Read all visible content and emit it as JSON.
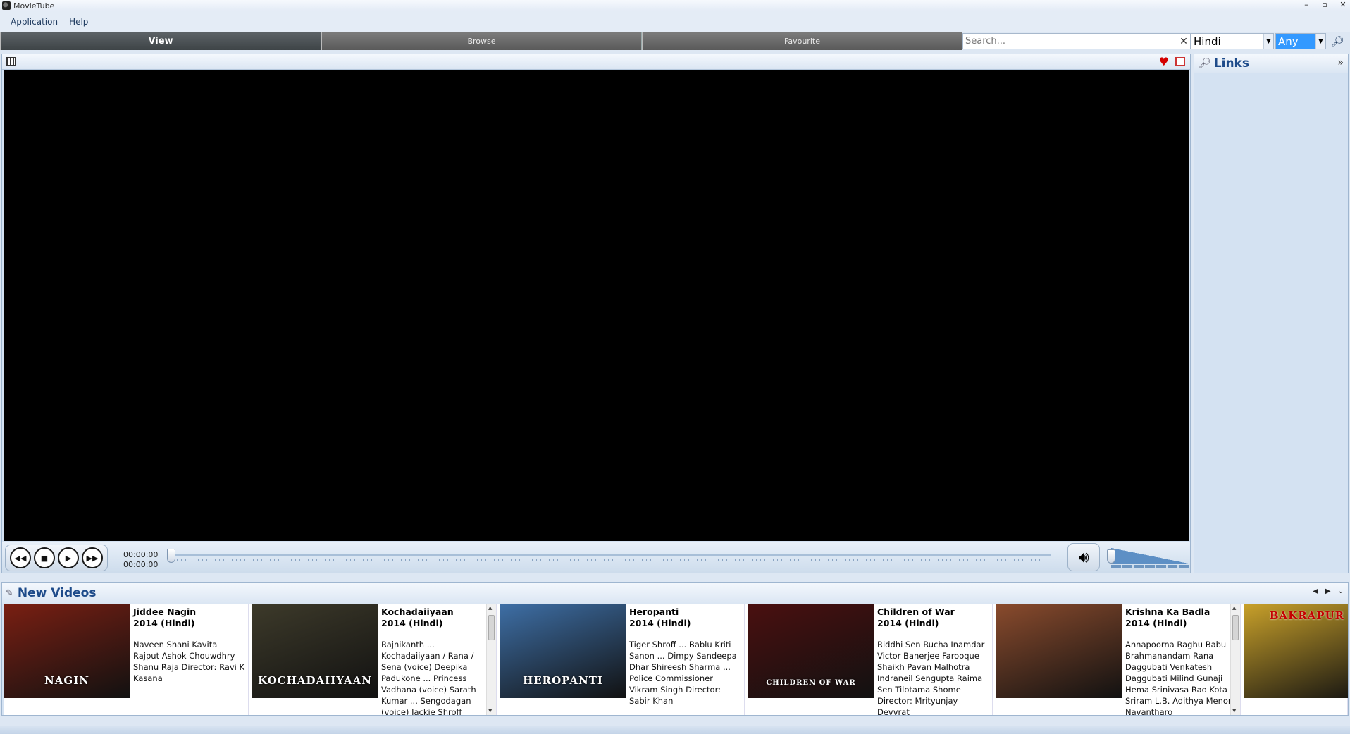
{
  "window": {
    "title": "MovieTube"
  },
  "menu": [
    "Application",
    "Help"
  ],
  "tabs": [
    {
      "label": "View",
      "active": true
    },
    {
      "label": "Browse",
      "active": false
    },
    {
      "label": "Favourite",
      "active": false
    }
  ],
  "search": {
    "placeholder": "Search...",
    "value": ""
  },
  "filters": {
    "language": "Hindi",
    "genre": "Any"
  },
  "player": {
    "time_current": "00:00:00",
    "time_total": "00:00:00",
    "progress": 0,
    "volume": 1.0
  },
  "icons": {
    "window_icon": "film-reel-icon",
    "player": "film-icon",
    "favourite": "heart-icon",
    "fullscreen": "fullscreen-icon",
    "links": "key-icon",
    "new_videos": "pin-icon",
    "search": "magnifier-icon",
    "volume": "speaker-icon"
  },
  "links": {
    "title": "Links"
  },
  "new_videos": {
    "title": "New Videos",
    "items": [
      {
        "name": "Jiddee Nagin",
        "year": "2014  (Hindi)",
        "cast": "Naveen Shani Kavita Rajput Ashok Chouwdhry Shanu Raja Director: Ravi K Kasana",
        "poster_text": "NAGIN",
        "poster_color": "#7a1f12"
      },
      {
        "name": "Kochadaiiyaan",
        "year": "2014  (Hindi)",
        "cast": "Rajnikanth ... Kochadaiiyaan / Rana / Sena (voice) Deepika Padukone ... Princess Vadhana (voice) Sarath Kumar ... Sengodagan (voice) Jackie Shroff",
        "poster_text": "KOCHADAIIYAAN",
        "poster_color": "#3d3a2a"
      },
      {
        "name": "Heropanti",
        "year": "2014  (Hindi)",
        "cast": "Tiger Shroff ... Bablu Kriti Sanon ... Dimpy Sandeepa Dhar Shireesh Sharma ... Police Commissioner Vikram Singh Director: Sabir Khan",
        "poster_text": "HEROPANTI",
        "poster_color": "#3e6fa6"
      },
      {
        "name": "Children of War",
        "year": "2014  (Hindi)",
        "cast": "Riddhi Sen Rucha Inamdar Victor Banerjee Farooque Shaikh Pavan Malhotra Indraneil Sengupta Raima Sen Tilotama Shome Director: Mrityunjay Devvrat",
        "poster_text": "CHILDREN OF WAR",
        "poster_color": "#4a1010"
      },
      {
        "name": "Krishna Ka Badla",
        "year": "2014  (Hindi)",
        "cast": "Annapoorna Raghu Babu Brahmanandam Rana Daggubati Venkatesh Daggubati Milind Gunaji Hema Srinivasa Rao Kota Sriram L.B. Adithya Menon Navantharo",
        "poster_text": "",
        "poster_color": "#8a4b2d"
      },
      {
        "name": "",
        "year": "",
        "cast": "",
        "poster_text": "BAKRAPUR",
        "poster_color": "#c9a12a"
      }
    ]
  }
}
